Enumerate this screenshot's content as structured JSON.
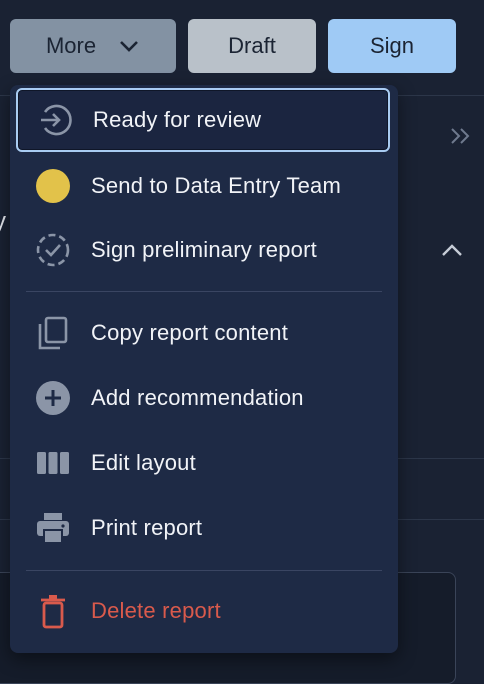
{
  "toolbar": {
    "more_label": "More",
    "draft_label": "Draft",
    "sign_label": "Sign"
  },
  "menu": {
    "items": [
      {
        "label": "Ready for review",
        "icon": "arrow-circle-right-icon",
        "focused": true
      },
      {
        "label": "Send to Data Entry Team",
        "icon": "yellow-dot-icon",
        "color": "#e2c24a"
      },
      {
        "label": "Sign preliminary report",
        "icon": "dashed-check-circle-icon"
      },
      {
        "label": "Copy report content",
        "icon": "copy-icon"
      },
      {
        "label": "Add recommendation",
        "icon": "plus-circle-icon"
      },
      {
        "label": "Edit layout",
        "icon": "columns-icon"
      },
      {
        "label": "Print report",
        "icon": "printer-icon"
      },
      {
        "label": "Delete report",
        "icon": "trash-icon",
        "color": "#d95a4c"
      }
    ]
  },
  "background": {
    "partial_text": "y"
  }
}
